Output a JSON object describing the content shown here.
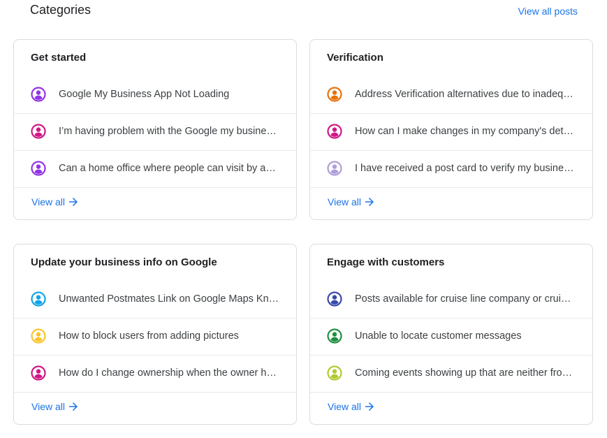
{
  "header": {
    "title": "Categories",
    "view_all_posts": "View all posts"
  },
  "cards": [
    {
      "title": "Get started",
      "items": [
        {
          "text": "Google My Business App Not Loading",
          "avatar_color": "#9334e6"
        },
        {
          "text": "I’m having problem with the Google my business account",
          "avatar_color": "#d01884"
        },
        {
          "text": "Can a home office where people can visit by appointment be listed",
          "avatar_color": "#9334e6"
        }
      ],
      "view_all": "View all"
    },
    {
      "title": "Verification",
      "items": [
        {
          "text": "Address Verification alternatives due to inadequate postal service",
          "avatar_color": "#e8710a"
        },
        {
          "text": "How can I make changes in my company's details",
          "avatar_color": "#d01884"
        },
        {
          "text": "I have received a post card to verify my business but",
          "avatar_color": "#af9ed8"
        }
      ],
      "view_all": "View all"
    },
    {
      "title": "Update your business info on Google",
      "items": [
        {
          "text": "Unwanted Postmates Link on Google Maps Knowledge Panel",
          "avatar_color": "#12a4e6"
        },
        {
          "text": "How to block users from adding pictures",
          "avatar_color": "#f9c52a"
        },
        {
          "text": "How do I change ownership when the owner has passed away",
          "avatar_color": "#d01884"
        }
      ],
      "view_all": "View all"
    },
    {
      "title": "Engage with customers",
      "items": [
        {
          "text": "Posts available for cruise line company or cruise ship",
          "avatar_color": "#3949ab"
        },
        {
          "text": "Unable to locate customer messages",
          "avatar_color": "#1e8e3e"
        },
        {
          "text": "Coming events showing up that are neither from us",
          "avatar_color": "#aecb2f"
        }
      ],
      "view_all": "View all"
    }
  ],
  "colors": {
    "link": "#1a73e8",
    "border": "#dadce0"
  }
}
